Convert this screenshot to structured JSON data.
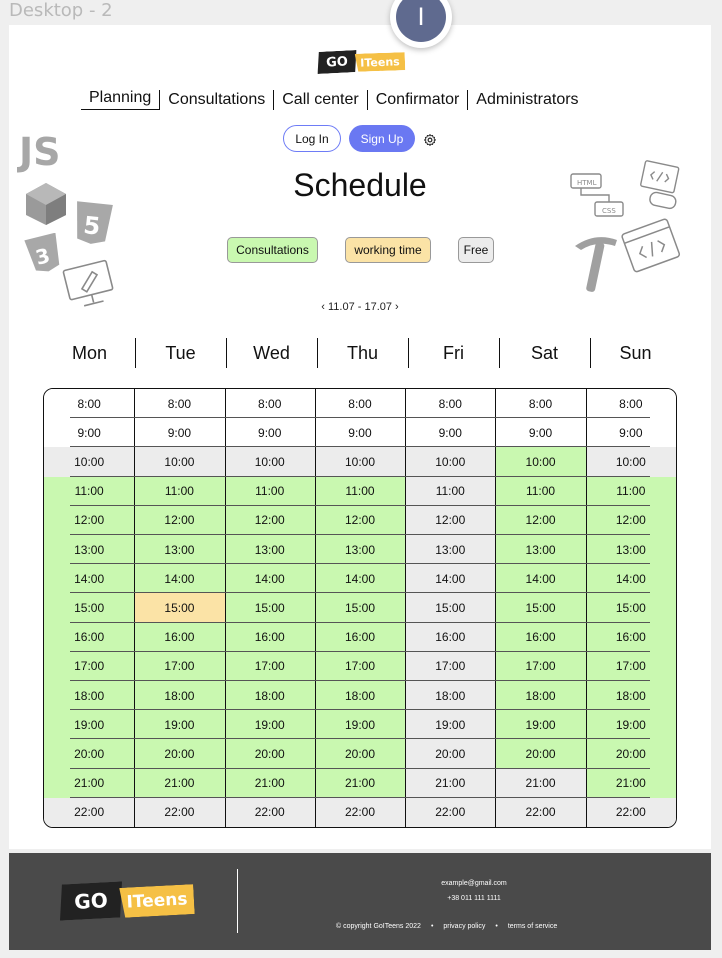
{
  "frame_label": "Desktop - 2",
  "avatar_letter": "I",
  "logo": {
    "go": "GO",
    "teens": "ITeens"
  },
  "nav": [
    "Planning",
    "Consultations",
    "Call center",
    "Confirmator",
    "Administrators"
  ],
  "nav_active": 0,
  "auth": {
    "login": "Log In",
    "signup": "Sign Up"
  },
  "title": "Schedule",
  "legend": {
    "consultations": "Consultations",
    "working": "working time",
    "free": "Free"
  },
  "week": "‹ 11.07 - 17.07 ›",
  "days": [
    "Mon",
    "Tue",
    "Wed",
    "Thu",
    "Fri",
    "Sat",
    "Sun"
  ],
  "times": [
    "8:00",
    "9:00",
    "10:00",
    "11:00",
    "12:00",
    "13:00",
    "14:00",
    "15:00",
    "16:00",
    "17:00",
    "18:00",
    "19:00",
    "20:00",
    "21:00",
    "22:00"
  ],
  "colors": {
    "consultation": "#c9f8b0",
    "working": "#fbe3a6",
    "free": "#ececec",
    "none": "#ffffff",
    "accent": "#6a78f2"
  },
  "status_grid": [
    [
      "none",
      "none",
      "none",
      "none",
      "none",
      "none",
      "none"
    ],
    [
      "none",
      "none",
      "none",
      "none",
      "none",
      "none",
      "none"
    ],
    [
      "free",
      "free",
      "free",
      "free",
      "free",
      "consultation",
      "free"
    ],
    [
      "consultation",
      "consultation",
      "consultation",
      "consultation",
      "free",
      "consultation",
      "consultation"
    ],
    [
      "consultation",
      "consultation",
      "consultation",
      "consultation",
      "free",
      "consultation",
      "consultation"
    ],
    [
      "consultation",
      "consultation",
      "consultation",
      "consultation",
      "free",
      "consultation",
      "consultation"
    ],
    [
      "consultation",
      "consultation",
      "consultation",
      "consultation",
      "free",
      "consultation",
      "consultation"
    ],
    [
      "consultation",
      "working",
      "consultation",
      "consultation",
      "free",
      "consultation",
      "consultation"
    ],
    [
      "consultation",
      "consultation",
      "consultation",
      "consultation",
      "free",
      "consultation",
      "consultation"
    ],
    [
      "consultation",
      "consultation",
      "consultation",
      "consultation",
      "free",
      "consultation",
      "consultation"
    ],
    [
      "consultation",
      "consultation",
      "consultation",
      "consultation",
      "free",
      "consultation",
      "consultation"
    ],
    [
      "consultation",
      "consultation",
      "consultation",
      "consultation",
      "free",
      "consultation",
      "consultation"
    ],
    [
      "consultation",
      "consultation",
      "consultation",
      "consultation",
      "free",
      "consultation",
      "consultation"
    ],
    [
      "consultation",
      "consultation",
      "consultation",
      "consultation",
      "free",
      "free",
      "consultation"
    ],
    [
      "free",
      "free",
      "free",
      "free",
      "free",
      "free",
      "free"
    ]
  ],
  "footer": {
    "email": "example@gmail.com",
    "phone": "+38 011 111 1111",
    "copyright": "© copyright GoITeens 2022",
    "privacy": "privacy policy",
    "terms": "terms of service"
  },
  "icon_names": [
    "js-icon",
    "cube-icon",
    "html5-icon",
    "css3-icon",
    "design-monitor-icon",
    "html-css-flow-icon",
    "code-gamepad-icon",
    "pickaxe-icon",
    "code-window-icon",
    "gear-icon"
  ]
}
